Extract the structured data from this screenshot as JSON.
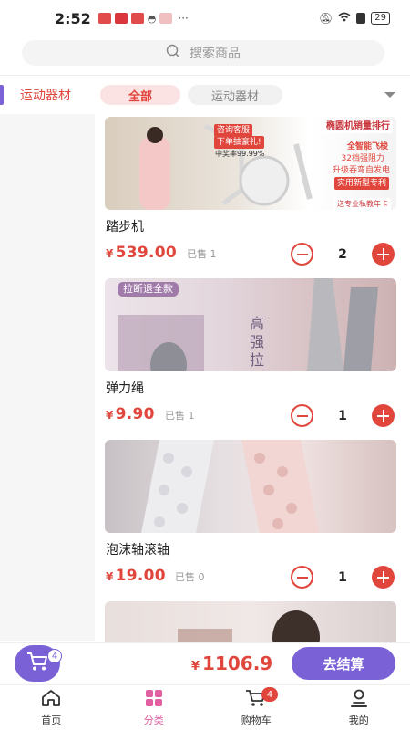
{
  "status_bar": {
    "time": "2:52",
    "battery": "29",
    "more": "···"
  },
  "search": {
    "placeholder": "搜索商品"
  },
  "sidebar": {
    "items": [
      {
        "label": "运动器材",
        "active": true
      }
    ]
  },
  "filters": {
    "chips": [
      {
        "label": "全部",
        "active": true
      },
      {
        "label": "运动器材",
        "active": false
      }
    ]
  },
  "products": [
    {
      "name": "踏步机",
      "currency": "¥",
      "price": "539.00",
      "sold": "已售 1",
      "quantity": "2",
      "ad_texts": [
        "椭圆机销量排行",
        "咨询客服",
        "下单抽豪礼!",
        "中奖率99.99%",
        "全智能飞梭",
        "32档强阻力",
        "升级吞弯自发电",
        "实用新型专利",
        "送专业私教年卡"
      ]
    },
    {
      "name": "弹力绳",
      "currency": "¥",
      "price": "9.90",
      "sold": "已售 1",
      "quantity": "1",
      "ad_texts": [
        "拉断退全款",
        "高",
        "强",
        "拉"
      ]
    },
    {
      "name": "泡沫轴滚轴",
      "currency": "¥",
      "price": "19.00",
      "sold": "已售 0",
      "quantity": "1",
      "ad_texts": []
    }
  ],
  "checkout": {
    "cart_count": "4",
    "currency": "¥",
    "total": "1106.9",
    "pay_label": "去结算"
  },
  "tabbar": {
    "tabs": [
      {
        "label": "首页",
        "icon": "home-icon"
      },
      {
        "label": "分类",
        "icon": "grid-icon",
        "active": true
      },
      {
        "label": "购物车",
        "icon": "cart-icon",
        "badge": "4"
      },
      {
        "label": "我的",
        "icon": "user-icon"
      }
    ]
  },
  "colors": {
    "accent_red": "#e0463c",
    "accent_purple": "#7a62d6",
    "tab_active": "#e05fa0"
  }
}
